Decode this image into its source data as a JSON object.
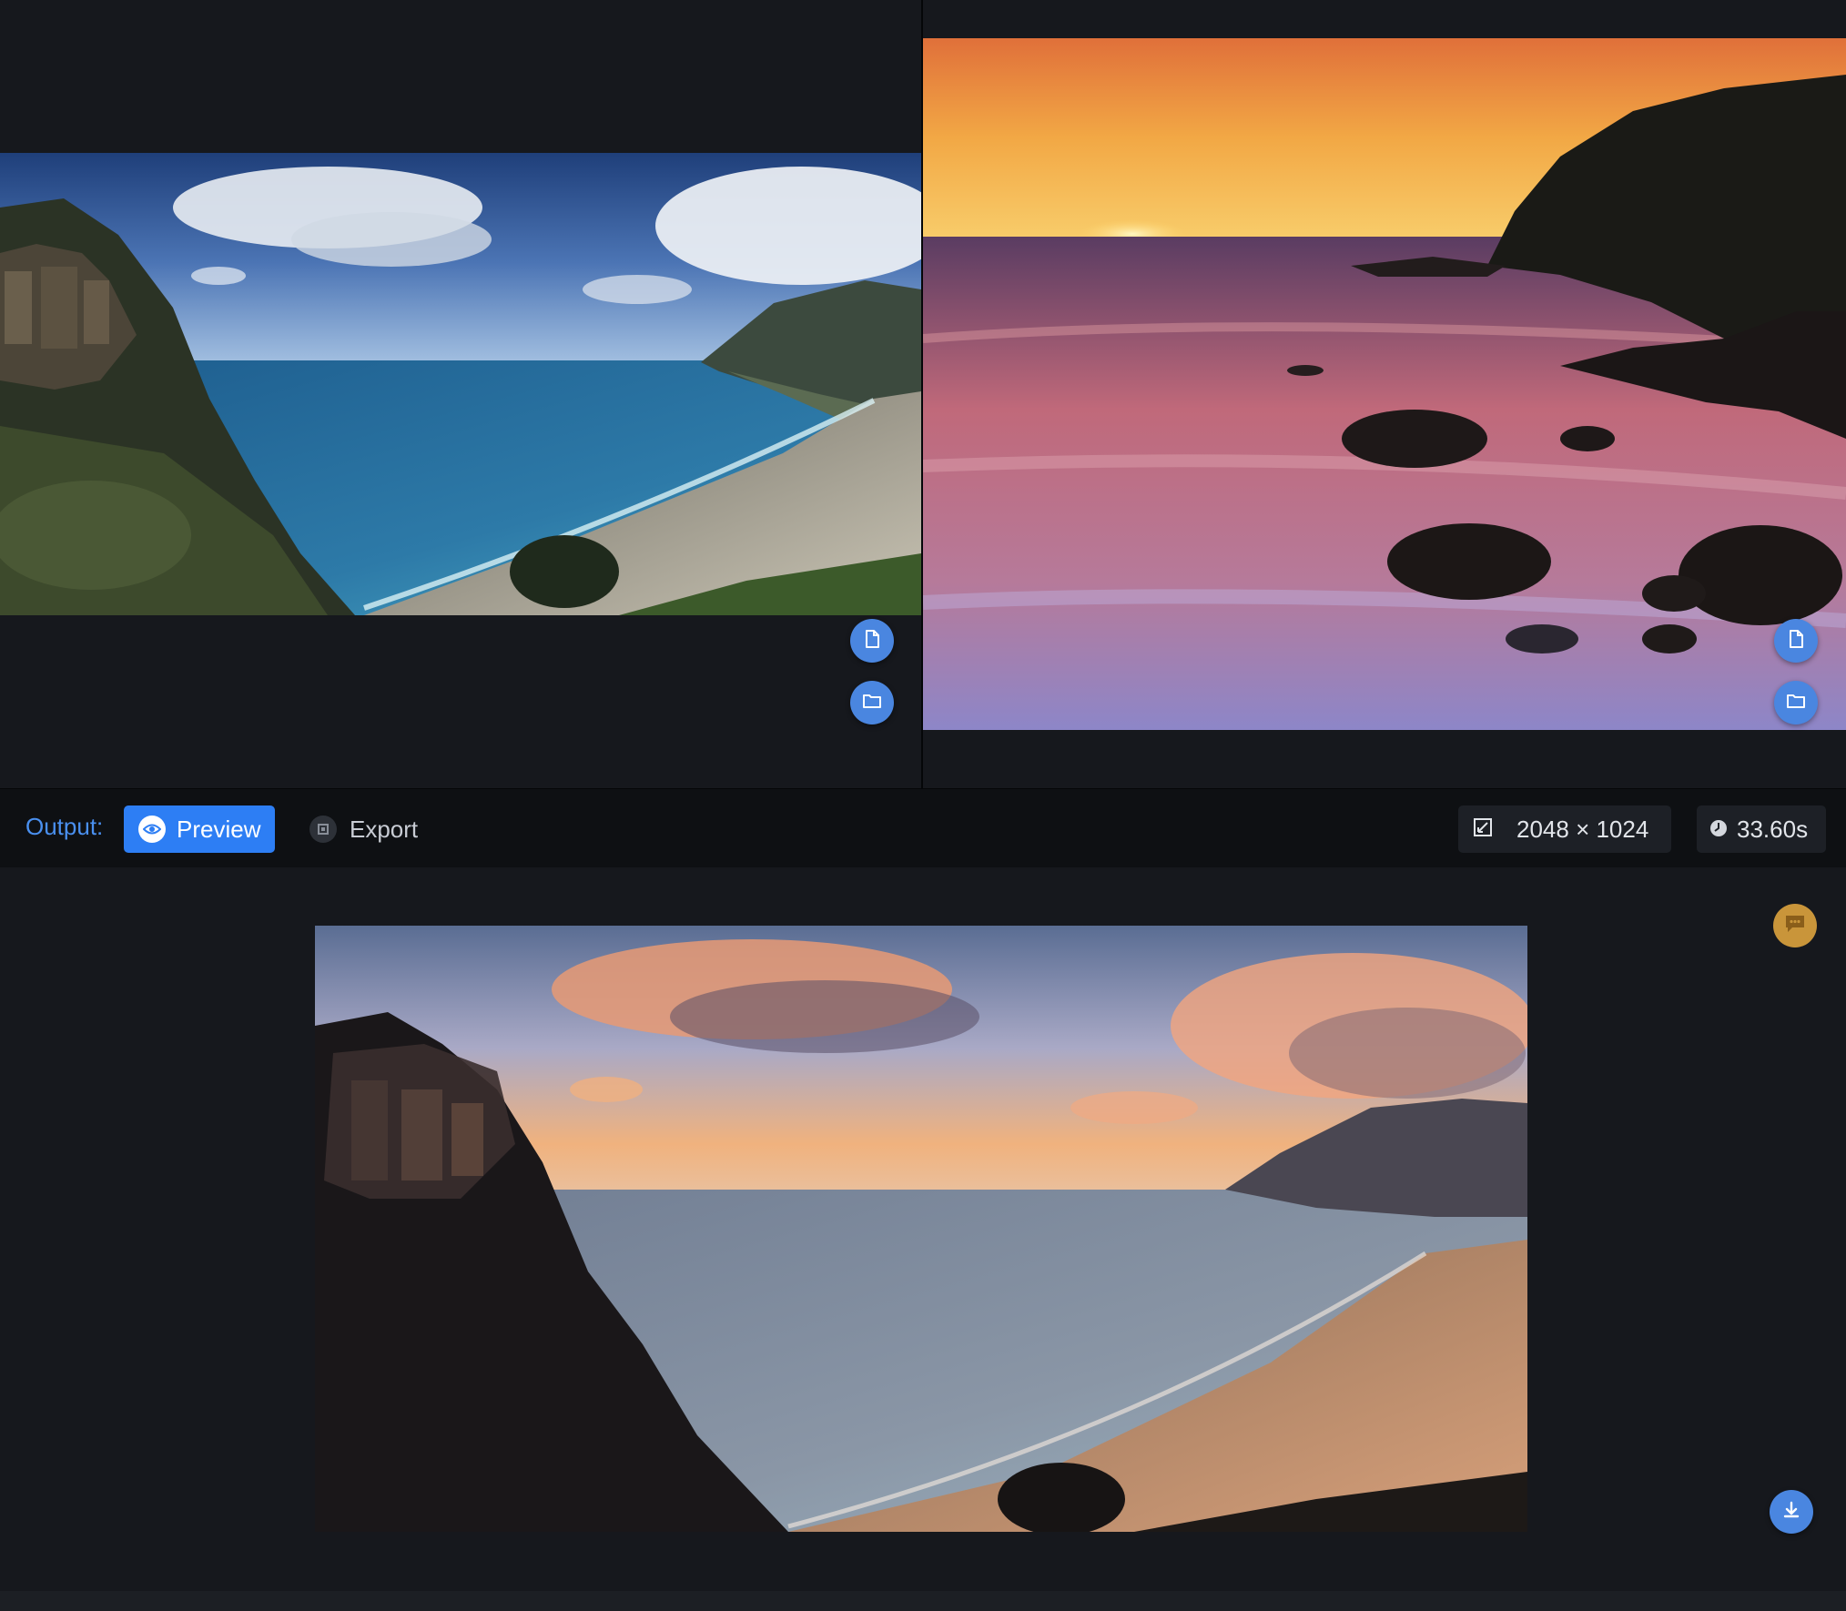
{
  "output_bar": {
    "label": "Output:",
    "tabs": [
      {
        "label": "Preview",
        "active": true,
        "icon": "eye-icon"
      },
      {
        "label": "Export",
        "active": false,
        "icon": "export-icon"
      }
    ],
    "dimensions": "2048 × 1024",
    "duration": "33.60s"
  },
  "input_images": [
    {
      "description_icon": "file-icon",
      "folder_icon": "folder-icon"
    },
    {
      "description_icon": "file-icon",
      "folder_icon": "folder-icon"
    }
  ],
  "colors": {
    "background": "#16181d",
    "bar_background": "#0e1013",
    "accent": "#2d7ef4",
    "label_accent": "#4a90f0",
    "fab": "#4a86e0",
    "feedback": "#c9953a"
  }
}
